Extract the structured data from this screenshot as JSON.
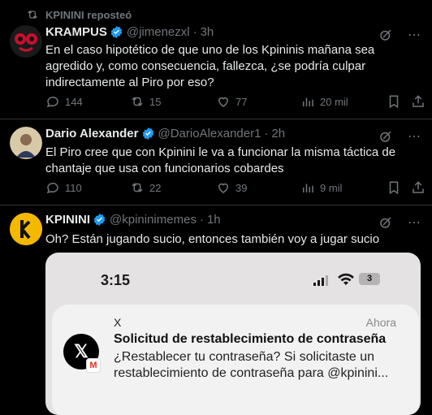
{
  "repost_header": {
    "label": "KPININI reposteó"
  },
  "posts": [
    {
      "display_name": "KRAMPUS",
      "handle": "@jimenezxl",
      "time": "3h",
      "text": "En el caso hipotético de que uno de los Kpininis mañana sea agredido y, como consecuencia, fallezca, ¿se podría culpar indirectamente al Piro por eso?",
      "replies": "144",
      "reposts": "15",
      "likes": "77",
      "views": "20 mil"
    },
    {
      "display_name": "Dario Alexander",
      "handle": "@DarioAlexander1",
      "time": "2h",
      "text": "El Piro cree que con Kpinini le va a funcionar la misma táctica de chantaje que usa con funcionarios cobardes",
      "replies": "110",
      "reposts": "22",
      "likes": "39",
      "views": "9 mil"
    },
    {
      "display_name": "KPININI",
      "handle": "@kpininimemes",
      "time": "1h",
      "text": "Oh? Están jugando sucio, entonces también voy a jugar sucio",
      "media": {
        "phone_time": "3:15",
        "battery": "3",
        "notification": {
          "app": "X",
          "time": "Ahora",
          "title": "Solicitud de restablecimiento de contraseña",
          "body": "¿Restablecer tu contraseña? Si solicitaste un restablecimiento de contraseña para @kpinini..."
        }
      }
    }
  ],
  "colors": {
    "verified": "#1d9bf0",
    "muted": "#71767b",
    "background": "#000000"
  }
}
